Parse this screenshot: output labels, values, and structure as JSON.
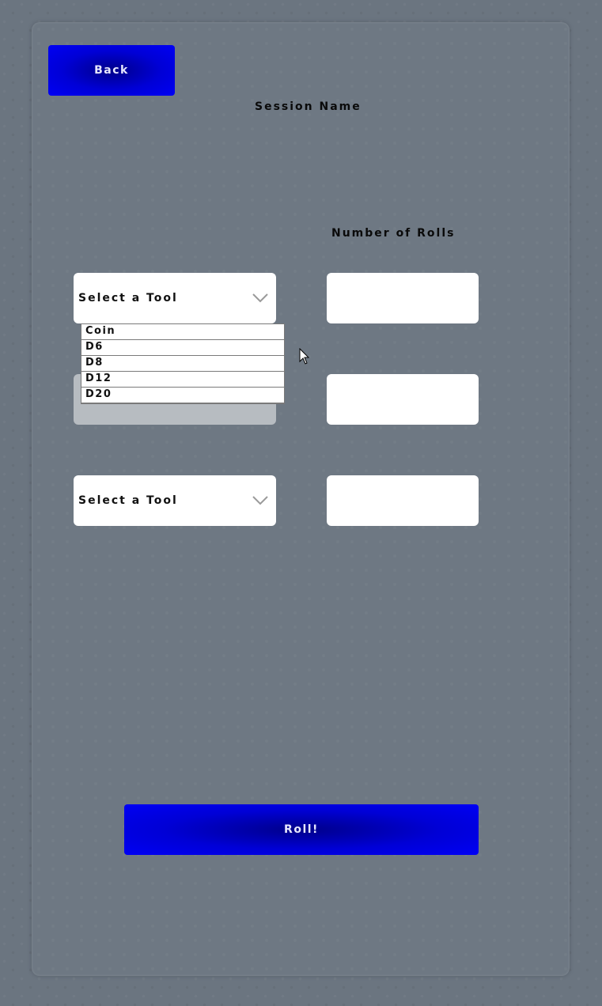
{
  "header": {
    "back_label": "Back",
    "session_name_label": "Session Name"
  },
  "rolls_header": {
    "label": "Number of Rolls"
  },
  "rows": [
    {
      "tool_selected": "Select a Tool",
      "rolls_value": ""
    },
    {
      "tool_selected": "",
      "rolls_value": ""
    },
    {
      "tool_selected": "Select a Tool",
      "rolls_value": ""
    }
  ],
  "dropdown": {
    "options": [
      "Coin",
      "D6",
      "D8",
      "D12",
      "D20"
    ]
  },
  "footer": {
    "roll_label": "Roll!"
  },
  "colors": {
    "button_blue": "#0000f5",
    "background": "#6b7580"
  },
  "icons": {
    "chevron": "chevron-down-icon",
    "cursor": "mouse-cursor-icon"
  }
}
